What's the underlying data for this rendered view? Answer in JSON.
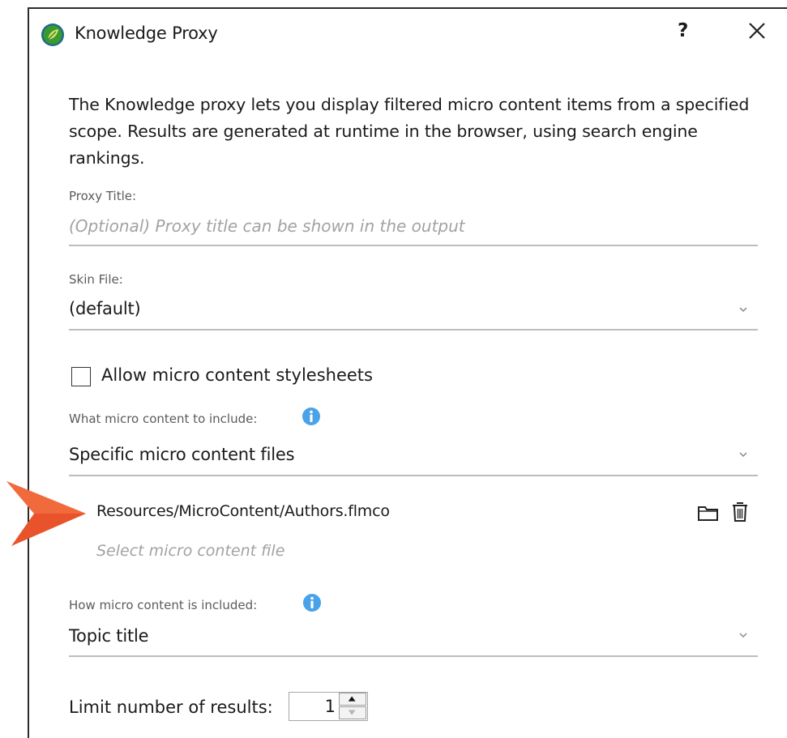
{
  "dialog": {
    "title": "Knowledge Proxy",
    "help_label": "?",
    "intro": "The Knowledge proxy lets you display filtered micro content items from a specified scope. Results are generated at runtime in the browser, using search engine rankings."
  },
  "proxy_title": {
    "label": "Proxy Title:",
    "placeholder": "(Optional) Proxy title can be shown in the output"
  },
  "skin_file": {
    "label": "Skin File:",
    "value": "(default)"
  },
  "stylesheets": {
    "label": "Allow micro content stylesheets",
    "checked": false
  },
  "what_to_include": {
    "label": "What micro content to include:",
    "value": "Specific micro content files",
    "files": [
      "Resources/MicroContent/Authors.flmco"
    ],
    "select_placeholder": "Select micro content file"
  },
  "how_included": {
    "label": "How micro content is included:",
    "value": "Topic title"
  },
  "limit": {
    "label": "Limit number of results:",
    "value": "1"
  },
  "colors": {
    "info_blue": "#4aa3e8",
    "pointer_orange": "#e8532b",
    "app_icon_green": "#3a9a2d"
  },
  "icons": [
    "app-logo-icon",
    "help-icon",
    "close-icon",
    "chevron-down-icon",
    "info-icon",
    "folder-icon",
    "trash-icon",
    "spin-up-icon",
    "spin-down-icon",
    "pointer-arrow-icon"
  ]
}
